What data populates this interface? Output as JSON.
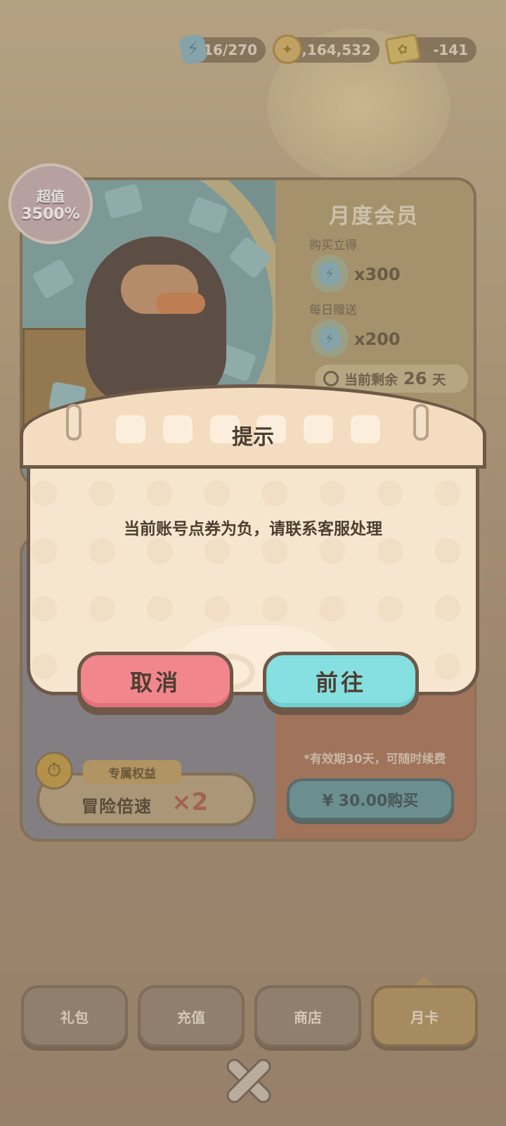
{
  "resources": {
    "energy": "16/270",
    "coins": "2,164,532",
    "tickets": "-141"
  },
  "card_monthly": {
    "badge_line1": "超值",
    "badge_line2": "3500%",
    "title": "月度会员",
    "buy_label": "购买立得",
    "buy_qty": "x300",
    "daily_label": "每日赠送",
    "daily_qty": "x200",
    "remain_prefix": "当前剩余",
    "remain_days": "26",
    "remain_suffix": "天"
  },
  "card_second": {
    "validity": "*有效期30天，可随时续费",
    "price_button": "¥ 30.00购买",
    "perk_tag": "专属权益",
    "perk_text": "冒险倍速",
    "perk_mult": "×2"
  },
  "tabs": [
    "礼包",
    "充值",
    "商店",
    "月卡"
  ],
  "active_tab": "月卡",
  "dialog": {
    "title": "提示",
    "message": "当前账号点券为负，请联系客服处理",
    "cancel": "取消",
    "confirm": "前往"
  }
}
